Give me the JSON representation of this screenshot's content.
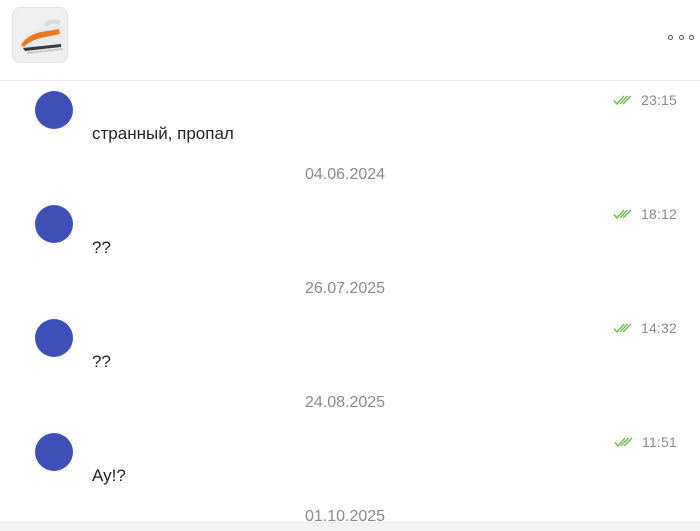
{
  "header": {
    "product_image": "iron-product-image",
    "menu_icon": "more-dots-icon"
  },
  "colors": {
    "avatar": "#3e4fb8",
    "read_check": "#6ec04a",
    "meta_text": "#8a8a8a"
  },
  "messages": [
    {
      "time": "23:15",
      "text": "странный, пропал",
      "status_icon": "double-check-icon"
    },
    {
      "time": "18:12",
      "text": "??",
      "status_icon": "double-check-icon"
    },
    {
      "time": "14:32",
      "text": "??",
      "status_icon": "double-check-icon"
    },
    {
      "time": "11:51",
      "text": "Ау!?",
      "status_icon": "double-check-icon"
    }
  ],
  "date_separators": [
    "04.06.2024",
    "26.07.2025",
    "24.08.2025",
    "01.10.2025"
  ]
}
